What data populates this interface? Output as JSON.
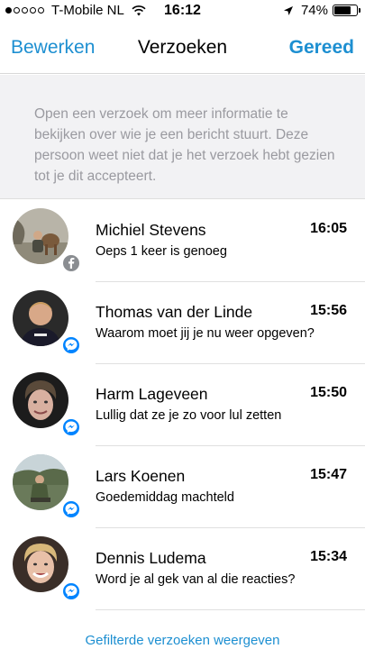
{
  "status_bar": {
    "carrier": "T-Mobile NL",
    "signal_bars_filled": 1,
    "signal_bars_total": 5,
    "time": "16:12",
    "battery_percent": "74%",
    "battery_level": 0.74
  },
  "nav": {
    "left_label": "Bewerken",
    "title": "Verzoeken",
    "right_label": "Gereed"
  },
  "info": {
    "text": "Open een verzoek om meer informatie te bekijken over wie je een bericht stuurt. Deze persoon weet niet dat je het verzoek hebt gezien tot je dit accepteert."
  },
  "requests": [
    {
      "name": "Michiel Stevens",
      "time": "16:05",
      "preview": "Oeps 1 keer is genoeg",
      "badge": "facebook-icon"
    },
    {
      "name": "Thomas van der Linde",
      "time": "15:56",
      "preview": "Waarom moet jij je nu weer opgeven?",
      "badge": "messenger-icon"
    },
    {
      "name": "Harm Lageveen",
      "time": "15:50",
      "preview": "Lullig dat ze je zo voor lul zetten",
      "badge": "messenger-icon"
    },
    {
      "name": "Lars Koenen",
      "time": "15:47",
      "preview": "Goedemiddag machteld",
      "badge": "messenger-icon"
    },
    {
      "name": "Dennis Ludema",
      "time": "15:34",
      "preview": "Word je al gek van al die reacties?",
      "badge": "messenger-icon"
    }
  ],
  "footer": {
    "link": "Gefilterde verzoeken weergeven"
  },
  "colors": {
    "accent": "#1d8fd1",
    "banner_bg": "#f2f2f4",
    "banner_text": "#9a9aa0",
    "facebook_badge": "#8a8d91",
    "messenger_badge": "#0084ff"
  }
}
